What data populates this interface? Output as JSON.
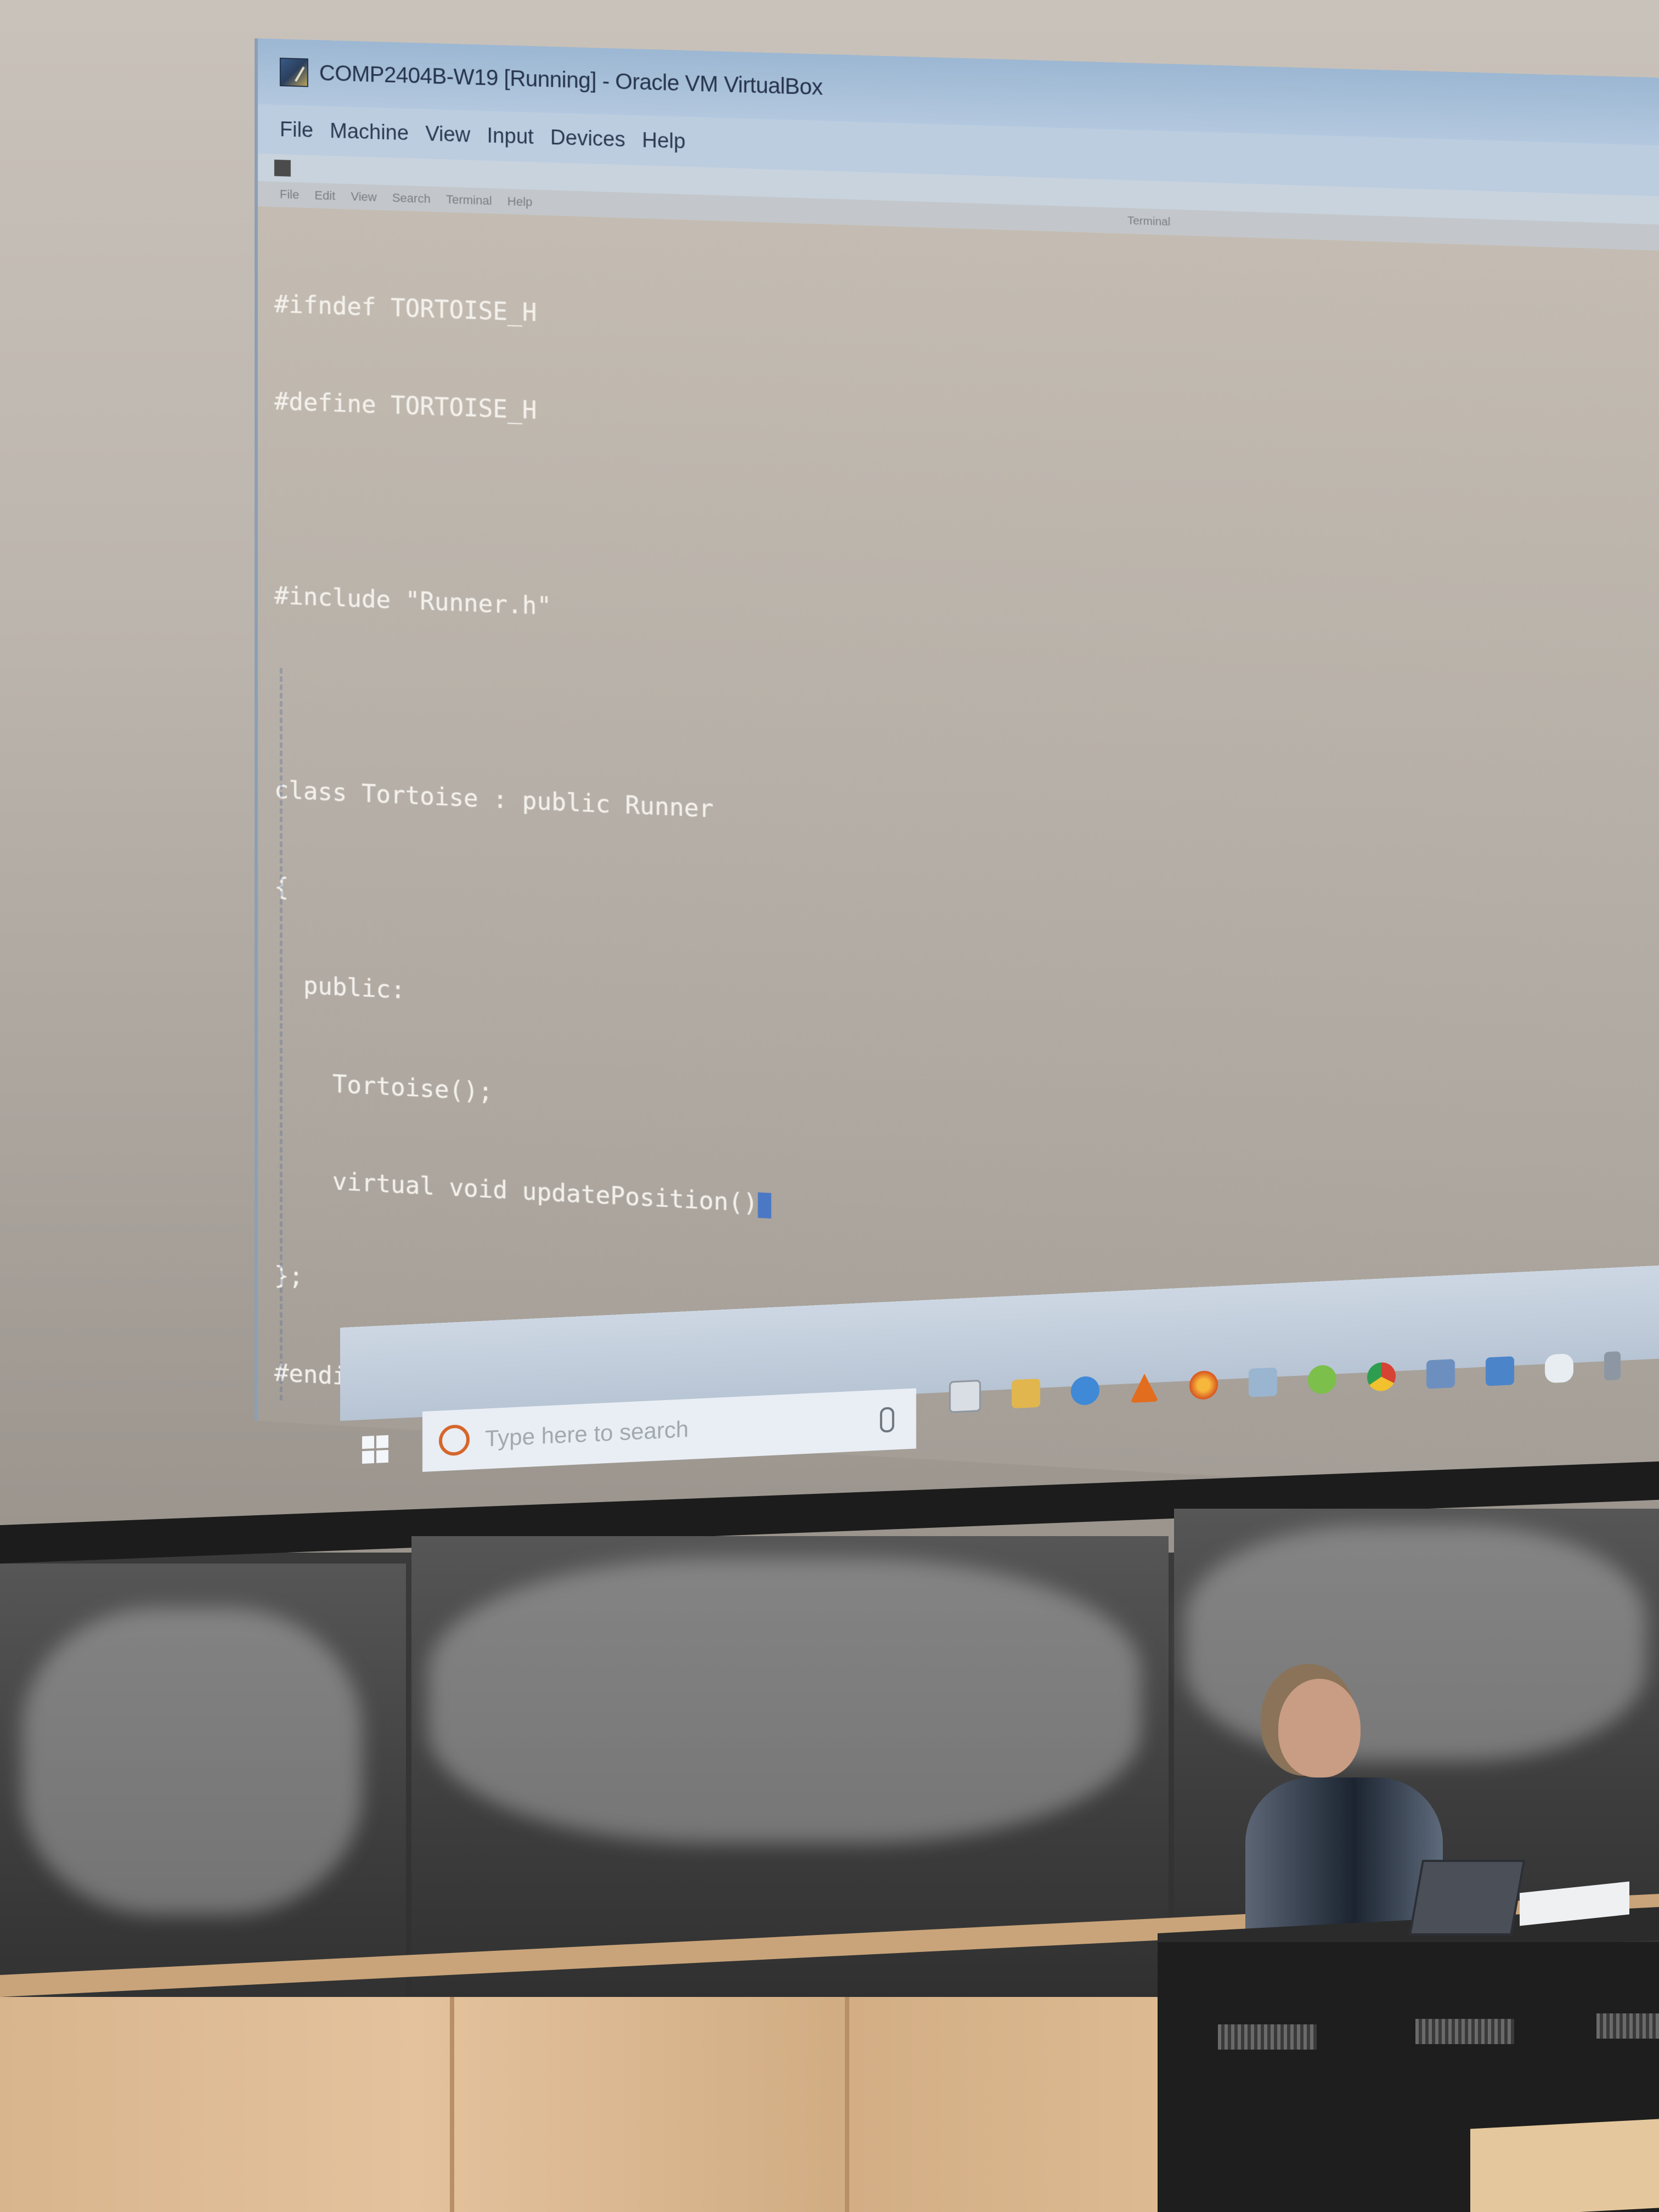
{
  "window": {
    "title": "COMP2404B-W19 [Running] - Oracle VM VirtualBox",
    "menu": [
      "File",
      "Machine",
      "View",
      "Input",
      "Devices",
      "Help"
    ]
  },
  "guest_terminal": {
    "menu": [
      "File",
      "Edit",
      "View",
      "Search",
      "Terminal",
      "Help"
    ],
    "title": "Terminal",
    "code_lines": [
      "#ifndef TORTOISE_H",
      "#define TORTOISE_H",
      "",
      "#include \"Runner.h\"",
      "",
      "class Tortoise : public Runner",
      "{",
      "  public:",
      "    Tortoise();",
      "    virtual void updatePosition()",
      "};",
      "#endif"
    ]
  },
  "taskbar": {
    "search_placeholder": "Type here to search",
    "icons": [
      "task-view-icon",
      "file-explorer-icon",
      "edge-icon",
      "vlc-icon",
      "firefox-icon",
      "virtualbox-icon",
      "refresh-icon",
      "chrome-icon",
      "store-icon",
      "mail-icon",
      "cloud-icon",
      "pin-icon"
    ]
  },
  "colors": {
    "titlebar": "#9cb7d3",
    "menubar": "#bccde0",
    "terminal_bg": "#b8b1a9",
    "code_text": "#f4f1ec",
    "cursor": "#4a78c4",
    "cortana": "#d5662b"
  }
}
